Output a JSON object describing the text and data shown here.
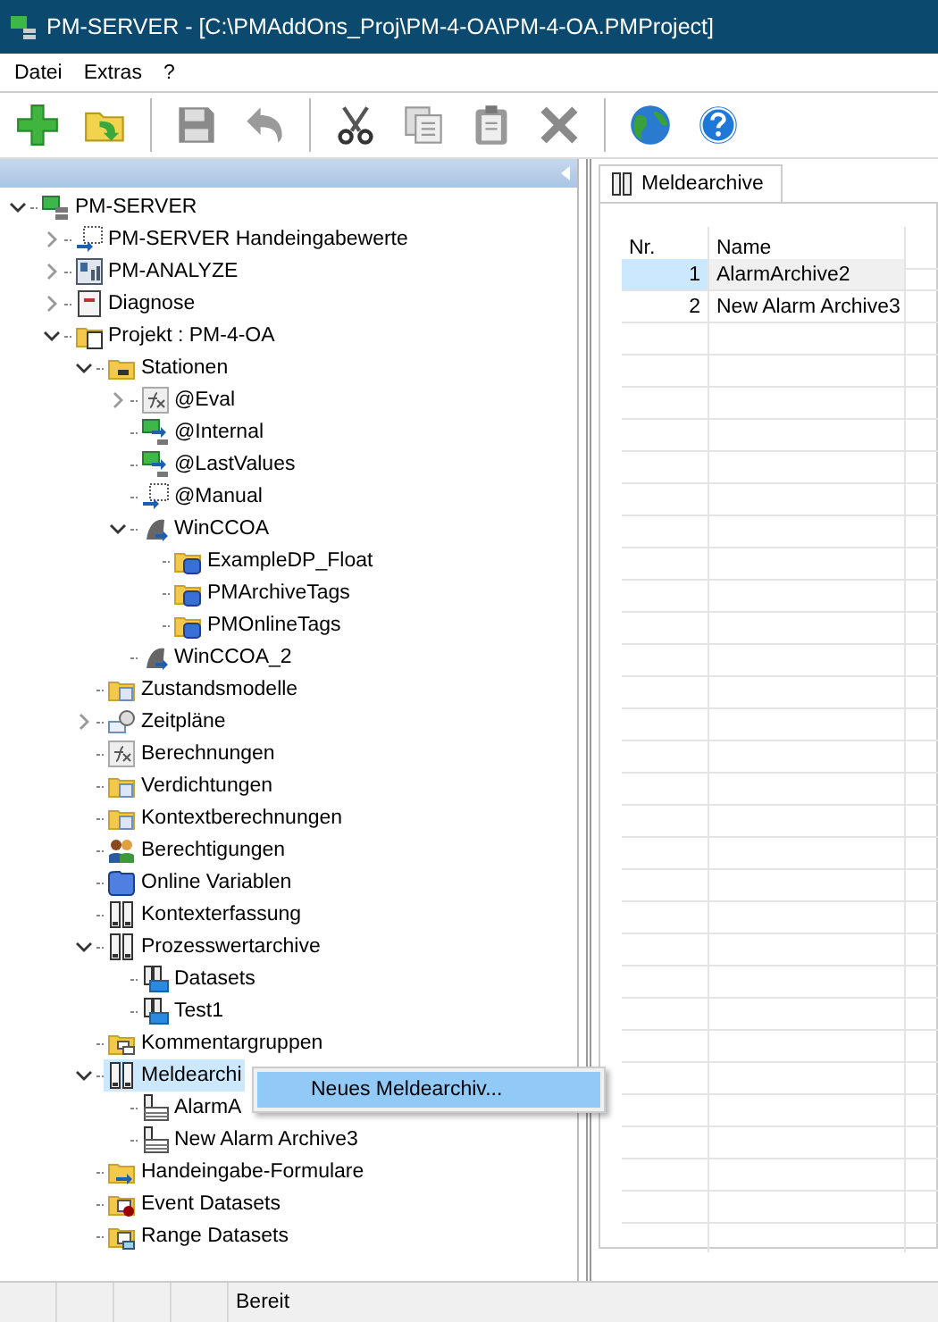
{
  "window": {
    "title": "PM-SERVER - [C:\\PMAddOns_Proj\\PM-4-OA\\PM-4-OA.PMProject]"
  },
  "menu": [
    "Datei",
    "Extras",
    "?"
  ],
  "toolbar": [
    {
      "disabled": false
    },
    {
      "disabled": false
    },
    {
      "disabled": true
    },
    {
      "disabled": true
    },
    {
      "disabled": false
    },
    {
      "disabled": true
    },
    {
      "disabled": true
    },
    {
      "disabled": true
    },
    {
      "disabled": false
    },
    {
      "disabled": false
    }
  ],
  "tree": {
    "items": [
      {
        "label": "PM-SERVER",
        "expanded": true,
        "selected": false,
        "children": [
          {
            "label": "PM-SERVER Handeingabewerte",
            "expanded": false,
            "selected": false
          },
          {
            "label": "PM-ANALYZE",
            "expanded": false,
            "selected": false
          },
          {
            "label": "Diagnose",
            "expanded": false,
            "selected": false
          },
          {
            "label": "Projekt : PM-4-OA",
            "expanded": true,
            "selected": false,
            "children": [
              {
                "label": "Stationen",
                "expanded": true,
                "selected": false,
                "children": [
                  {
                    "label": "@Eval",
                    "expanded": false,
                    "selected": false
                  },
                  {
                    "label": "@Internal",
                    "selected": false
                  },
                  {
                    "label": "@LastValues",
                    "selected": false
                  },
                  {
                    "label": "@Manual",
                    "selected": false
                  },
                  {
                    "label": "WinCCOA",
                    "expanded": true,
                    "selected": false,
                    "children": [
                      {
                        "label": "ExampleDP_Float",
                        "selected": false
                      },
                      {
                        "label": "PMArchiveTags",
                        "selected": false
                      },
                      {
                        "label": "PMOnlineTags",
                        "selected": false
                      }
                    ]
                  },
                  {
                    "label": "WinCCOA_2",
                    "selected": false
                  }
                ]
              },
              {
                "label": "Zustandsmodelle",
                "selected": false
              },
              {
                "label": "Zeitpläne",
                "expanded": false,
                "selected": false
              },
              {
                "label": "Berechnungen",
                "selected": false
              },
              {
                "label": "Verdichtungen",
                "selected": false
              },
              {
                "label": "Kontextberechnungen",
                "selected": false
              },
              {
                "label": "Berechtigungen",
                "selected": false
              },
              {
                "label": "Online Variablen",
                "selected": false
              },
              {
                "label": "Kontexterfassung",
                "selected": false
              },
              {
                "label": "Prozesswertarchive",
                "expanded": true,
                "selected": false,
                "children": [
                  {
                    "label": "Datasets",
                    "selected": false
                  },
                  {
                    "label": "Test1",
                    "selected": false
                  }
                ]
              },
              {
                "label": "Kommentargruppen",
                "selected": false
              },
              {
                "label": "Meldearchi",
                "expanded": true,
                "selected": true,
                "children": [
                  {
                    "label": "AlarmA",
                    "selected": false
                  },
                  {
                    "label": "New Alarm Archive3",
                    "selected": false
                  }
                ]
              },
              {
                "label": "Handeingabe-Formulare",
                "selected": false
              },
              {
                "label": "Event Datasets",
                "selected": false
              },
              {
                "label": "Range Datasets",
                "selected": false
              }
            ]
          }
        ]
      }
    ]
  },
  "context_menu": {
    "items": [
      {
        "label": "Neues Meldearchiv...",
        "selected": true
      }
    ]
  },
  "panel": {
    "tabs": [
      {
        "label": "Meldearchive",
        "selected": true
      }
    ],
    "table": {
      "columns": [
        "Nr.",
        "Name"
      ],
      "rows": [
        {
          "cells": [
            "1",
            "AlarmArchive2"
          ],
          "selected": true
        },
        {
          "cells": [
            "2",
            "New Alarm Archive3"
          ],
          "selected": false
        }
      ]
    }
  },
  "status_bar": {
    "text": "Bereit"
  }
}
